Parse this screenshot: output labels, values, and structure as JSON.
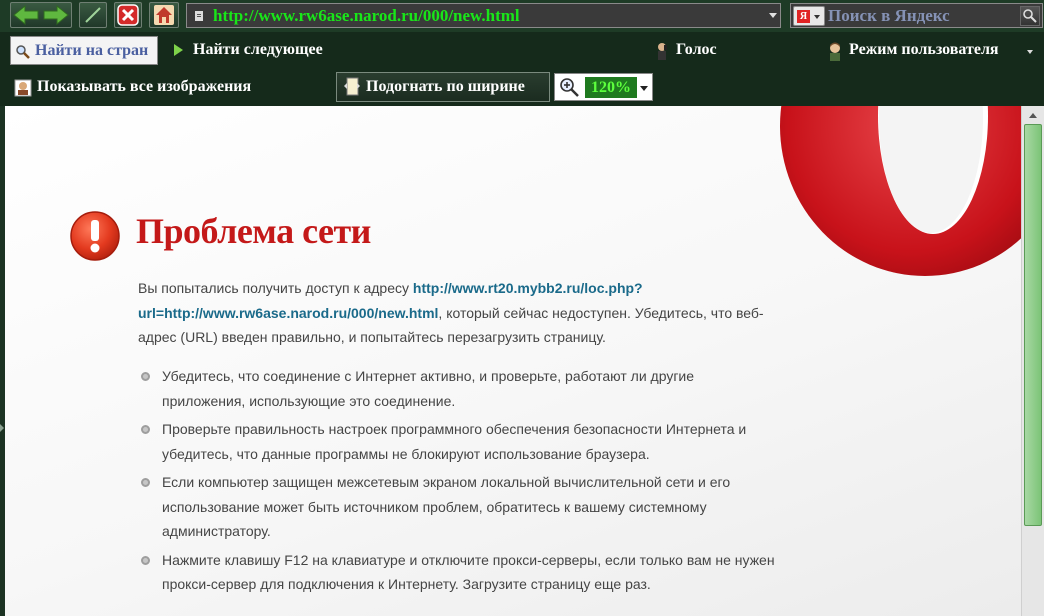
{
  "toolbar": {
    "address_url": "http://www.rw6ase.narod.ru/000/new.html",
    "search_placeholder": "Поиск в Яндекс",
    "search_engine_icon_letter": "Я",
    "find_placeholder": "Найти на стран",
    "find_next_label": "Найти следующее",
    "voice_label": "Голос",
    "user_mode_label": "Режим пользователя",
    "show_images_label": "Показывать все изображения",
    "fit_width_label": "Подогнать по ширине",
    "zoom_value": "120%"
  },
  "error_page": {
    "title": "Проблема сети",
    "intro_before_link": "Вы попытались получить доступ к адресу ",
    "link": "http://www.rt20.mybb2.ru/loc.php?url=http://www.rw6ase.narod.ru/000/new.html",
    "intro_after_link": ", который сейчас недоступен. Убедитесь, что веб-адрес (URL) введен правильно, и попытайтесь перезагрузить страницу.",
    "bullets": [
      "Убедитесь, что соединение с Интернет активно, и проверьте, работают ли другие приложения, использующие это соединение.",
      "Проверьте правильность настроек программного обеспечения безопасности Интернета и убедитесь, что данные программы не блокируют использование браузера.",
      "Если компьютер защищен межсетевым экраном локальной вычислительной сети и его использование может быть источником проблем, обратитесь к вашему системному администратору.",
      "Нажмите клавишу F12 на клавиатуре и отключите прокси-серверы, если только вам не нужен прокси-сервер для подключения к Интернету. Загрузите страницу еще раз."
    ]
  },
  "colors": {
    "toolbar_bg": "#1e3b26",
    "url_text": "#19e619",
    "error_title": "#c41919",
    "link": "#1a6a8a",
    "zoom_bg": "#1f7a1f",
    "scroll_thumb": "#7cc477"
  },
  "icons": {
    "back": "arrow-left-icon",
    "forward": "arrow-right-icon",
    "edit": "pencil-icon",
    "stop": "close-icon",
    "home": "home-icon",
    "find": "search-icon",
    "find_next": "play-icon",
    "voice": "voice-icon",
    "user_mode": "user-icon",
    "show_images": "image-icon",
    "fit_width": "page-icon",
    "zoom": "zoom-icon",
    "error": "exclamation-icon",
    "brand": "opera-logo"
  }
}
